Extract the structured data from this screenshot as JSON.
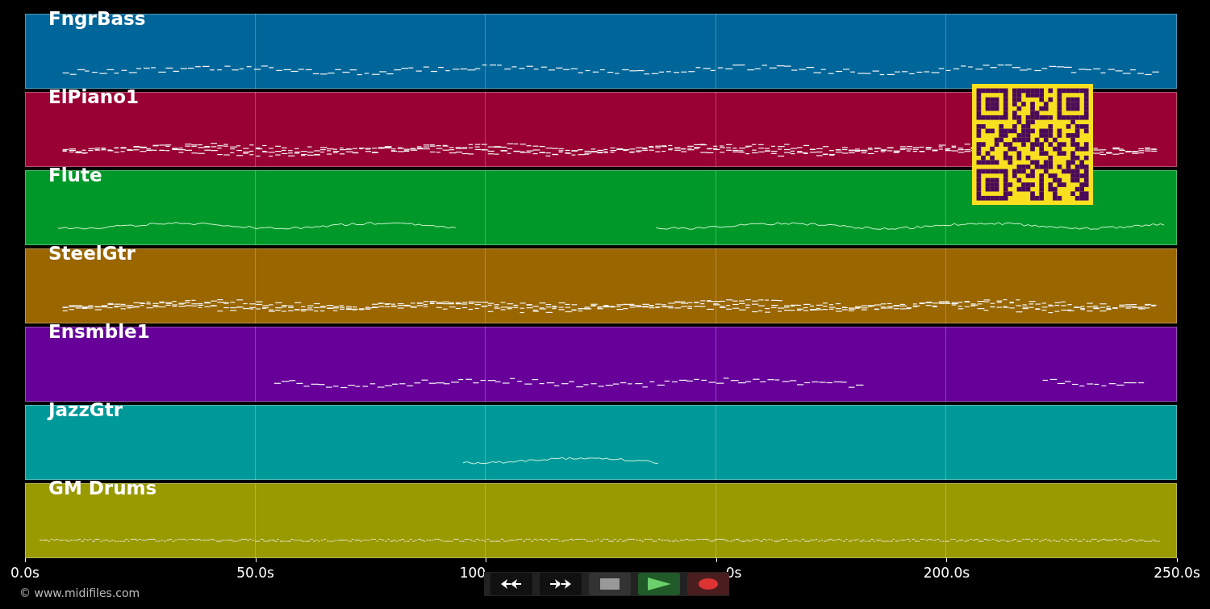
{
  "tracks": [
    {
      "name": "FngrBass",
      "color": "#006699",
      "kind": "bass"
    },
    {
      "name": "ElPiano1",
      "color": "#990033",
      "kind": "chords"
    },
    {
      "name": "Flute",
      "color": "#009929",
      "kind": "melody"
    },
    {
      "name": "SteelGtr",
      "color": "#996600",
      "kind": "chords"
    },
    {
      "name": "Ensmble1",
      "color": "#660099",
      "kind": "bass"
    },
    {
      "name": "JazzGtr",
      "color": "#009999",
      "kind": "melody"
    },
    {
      "name": "GM Drums",
      "color": "#999900",
      "kind": "drums"
    }
  ],
  "axis": {
    "ticks": [
      "0.0s",
      "50.0s",
      "100",
      "0s",
      "200.0s",
      "250.0s"
    ]
  },
  "copyright": "© www.midifiles.com",
  "controls": [
    {
      "kind": "rewind"
    },
    {
      "kind": "forward"
    },
    {
      "kind": "stop"
    },
    {
      "kind": "play"
    },
    {
      "kind": "record"
    }
  ]
}
